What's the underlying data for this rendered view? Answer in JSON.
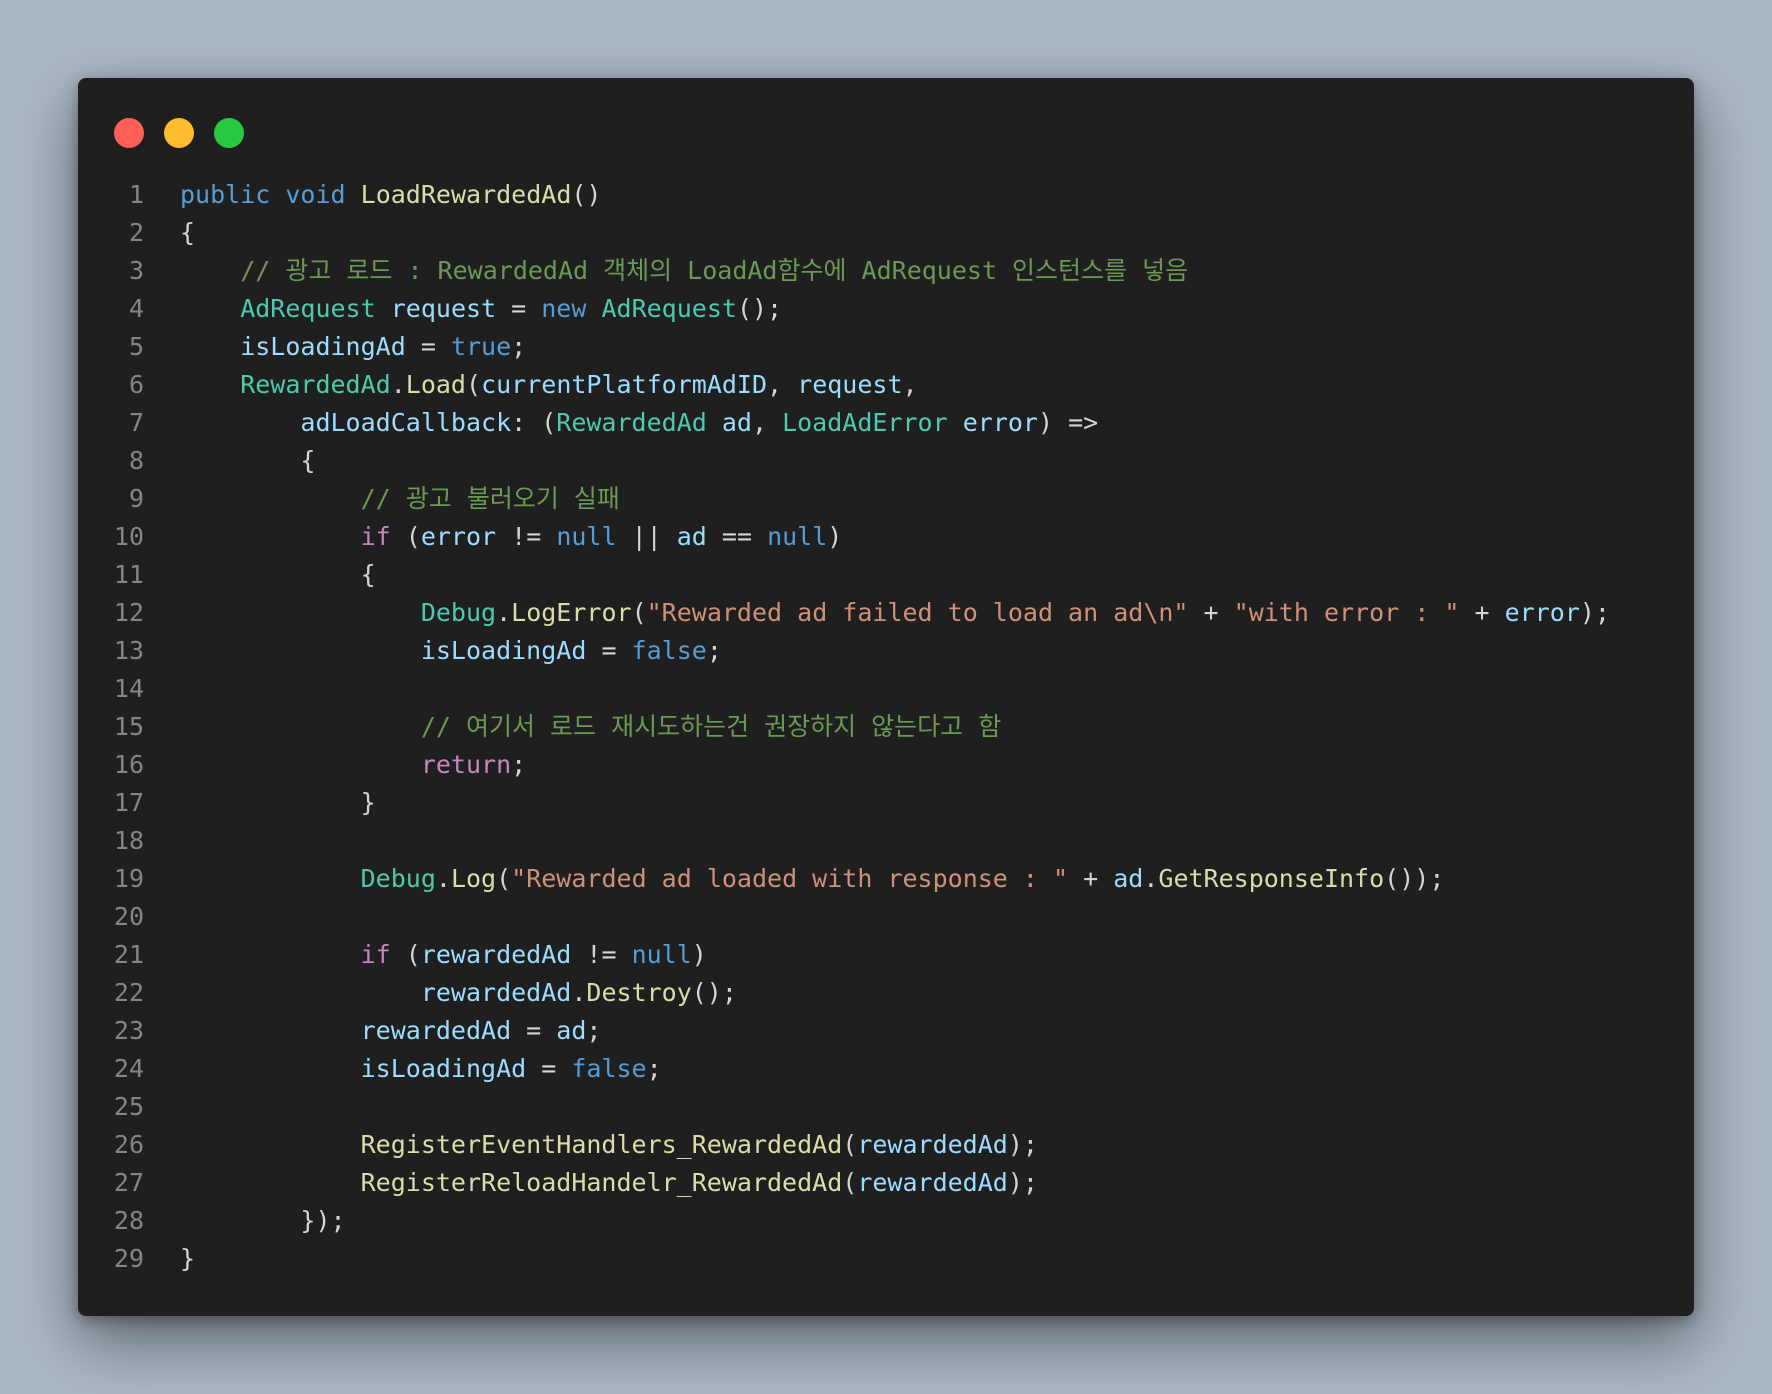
{
  "window": {
    "controls": [
      {
        "name": "close-button",
        "color": "#ff5f57"
      },
      {
        "name": "minimize-button",
        "color": "#febc2e"
      },
      {
        "name": "zoom-button",
        "color": "#28c840"
      }
    ]
  },
  "colors": {
    "keyword": "#569cd6",
    "control": "#c586c0",
    "type": "#4ec9b0",
    "function": "#dcdcaa",
    "variable": "#9cdcfe",
    "string": "#ce9178",
    "comment": "#6a9955",
    "plain": "#d4d4d4",
    "gutter": "#858585"
  },
  "code_lines": [
    {
      "n": "1",
      "indent": 0,
      "tokens": [
        [
          "public",
          "keyword"
        ],
        [
          " ",
          "plain"
        ],
        [
          "void",
          "keyword"
        ],
        [
          " ",
          "plain"
        ],
        [
          "LoadRewardedAd",
          "function"
        ],
        [
          "()",
          "plain"
        ]
      ]
    },
    {
      "n": "2",
      "indent": 0,
      "tokens": [
        [
          "{",
          "plain"
        ]
      ]
    },
    {
      "n": "3",
      "indent": 4,
      "tokens": [
        [
          "// 광고 로드 : RewardedAd 객체의 LoadAd함수에 AdRequest 인스턴스를 넣음",
          "comment"
        ]
      ]
    },
    {
      "n": "4",
      "indent": 4,
      "tokens": [
        [
          "AdRequest",
          "type"
        ],
        [
          " ",
          "plain"
        ],
        [
          "request",
          "variable"
        ],
        [
          " = ",
          "plain"
        ],
        [
          "new",
          "keyword"
        ],
        [
          " ",
          "plain"
        ],
        [
          "AdRequest",
          "type"
        ],
        [
          "();",
          "plain"
        ]
      ]
    },
    {
      "n": "5",
      "indent": 4,
      "tokens": [
        [
          "isLoadingAd",
          "variable"
        ],
        [
          " = ",
          "plain"
        ],
        [
          "true",
          "keyword"
        ],
        [
          ";",
          "plain"
        ]
      ]
    },
    {
      "n": "6",
      "indent": 4,
      "tokens": [
        [
          "RewardedAd",
          "type"
        ],
        [
          ".",
          "plain"
        ],
        [
          "Load",
          "function"
        ],
        [
          "(",
          "plain"
        ],
        [
          "currentPlatformAdID",
          "variable"
        ],
        [
          ", ",
          "plain"
        ],
        [
          "request",
          "variable"
        ],
        [
          ",",
          "plain"
        ]
      ]
    },
    {
      "n": "7",
      "indent": 8,
      "tokens": [
        [
          "adLoadCallback",
          "variable"
        ],
        [
          ": (",
          "plain"
        ],
        [
          "RewardedAd",
          "type"
        ],
        [
          " ",
          "plain"
        ],
        [
          "ad",
          "variable"
        ],
        [
          ", ",
          "plain"
        ],
        [
          "LoadAdError",
          "type"
        ],
        [
          " ",
          "plain"
        ],
        [
          "error",
          "variable"
        ],
        [
          ") =>",
          "plain"
        ]
      ]
    },
    {
      "n": "8",
      "indent": 8,
      "tokens": [
        [
          "{",
          "plain"
        ]
      ]
    },
    {
      "n": "9",
      "indent": 12,
      "tokens": [
        [
          "// 광고 불러오기 실패",
          "comment"
        ]
      ]
    },
    {
      "n": "10",
      "indent": 12,
      "tokens": [
        [
          "if",
          "control"
        ],
        [
          " (",
          "plain"
        ],
        [
          "error",
          "variable"
        ],
        [
          " != ",
          "plain"
        ],
        [
          "null",
          "keyword"
        ],
        [
          " || ",
          "plain"
        ],
        [
          "ad",
          "variable"
        ],
        [
          " == ",
          "plain"
        ],
        [
          "null",
          "keyword"
        ],
        [
          ")",
          "plain"
        ]
      ]
    },
    {
      "n": "11",
      "indent": 12,
      "tokens": [
        [
          "{",
          "plain"
        ]
      ]
    },
    {
      "n": "12",
      "indent": 16,
      "tokens": [
        [
          "Debug",
          "type"
        ],
        [
          ".",
          "plain"
        ],
        [
          "LogError",
          "function"
        ],
        [
          "(",
          "plain"
        ],
        [
          "\"Rewarded ad failed to load an ad\\n\"",
          "string"
        ],
        [
          " + ",
          "plain"
        ],
        [
          "\"with error : \"",
          "string"
        ],
        [
          " + ",
          "plain"
        ],
        [
          "error",
          "variable"
        ],
        [
          ");",
          "plain"
        ]
      ]
    },
    {
      "n": "13",
      "indent": 16,
      "tokens": [
        [
          "isLoadingAd",
          "variable"
        ],
        [
          " = ",
          "plain"
        ],
        [
          "false",
          "keyword"
        ],
        [
          ";",
          "plain"
        ]
      ]
    },
    {
      "n": "14",
      "indent": 0,
      "tokens": []
    },
    {
      "n": "15",
      "indent": 16,
      "tokens": [
        [
          "// 여기서 로드 재시도하는건 권장하지 않는다고 함",
          "comment"
        ]
      ]
    },
    {
      "n": "16",
      "indent": 16,
      "tokens": [
        [
          "return",
          "control"
        ],
        [
          ";",
          "plain"
        ]
      ]
    },
    {
      "n": "17",
      "indent": 12,
      "tokens": [
        [
          "}",
          "plain"
        ]
      ]
    },
    {
      "n": "18",
      "indent": 0,
      "tokens": []
    },
    {
      "n": "19",
      "indent": 12,
      "tokens": [
        [
          "Debug",
          "type"
        ],
        [
          ".",
          "plain"
        ],
        [
          "Log",
          "function"
        ],
        [
          "(",
          "plain"
        ],
        [
          "\"Rewarded ad loaded with response : \"",
          "string"
        ],
        [
          " + ",
          "plain"
        ],
        [
          "ad",
          "variable"
        ],
        [
          ".",
          "plain"
        ],
        [
          "GetResponseInfo",
          "function"
        ],
        [
          "());",
          "plain"
        ]
      ]
    },
    {
      "n": "20",
      "indent": 0,
      "tokens": []
    },
    {
      "n": "21",
      "indent": 12,
      "tokens": [
        [
          "if",
          "control"
        ],
        [
          " (",
          "plain"
        ],
        [
          "rewardedAd",
          "variable"
        ],
        [
          " != ",
          "plain"
        ],
        [
          "null",
          "keyword"
        ],
        [
          ")",
          "plain"
        ]
      ]
    },
    {
      "n": "22",
      "indent": 16,
      "tokens": [
        [
          "rewardedAd",
          "variable"
        ],
        [
          ".",
          "plain"
        ],
        [
          "Destroy",
          "function"
        ],
        [
          "();",
          "plain"
        ]
      ]
    },
    {
      "n": "23",
      "indent": 12,
      "tokens": [
        [
          "rewardedAd",
          "variable"
        ],
        [
          " = ",
          "plain"
        ],
        [
          "ad",
          "variable"
        ],
        [
          ";",
          "plain"
        ]
      ]
    },
    {
      "n": "24",
      "indent": 12,
      "tokens": [
        [
          "isLoadingAd",
          "variable"
        ],
        [
          " = ",
          "plain"
        ],
        [
          "false",
          "keyword"
        ],
        [
          ";",
          "plain"
        ]
      ]
    },
    {
      "n": "25",
      "indent": 0,
      "tokens": []
    },
    {
      "n": "26",
      "indent": 12,
      "tokens": [
        [
          "RegisterEventHandlers_RewardedAd",
          "function"
        ],
        [
          "(",
          "plain"
        ],
        [
          "rewardedAd",
          "variable"
        ],
        [
          ");",
          "plain"
        ]
      ]
    },
    {
      "n": "27",
      "indent": 12,
      "tokens": [
        [
          "RegisterReloadHandelr_RewardedAd",
          "function"
        ],
        [
          "(",
          "plain"
        ],
        [
          "rewardedAd",
          "variable"
        ],
        [
          ");",
          "plain"
        ]
      ]
    },
    {
      "n": "28",
      "indent": 8,
      "tokens": [
        [
          "});",
          "plain"
        ]
      ]
    },
    {
      "n": "29",
      "indent": 0,
      "tokens": [
        [
          "}",
          "plain"
        ]
      ]
    }
  ]
}
